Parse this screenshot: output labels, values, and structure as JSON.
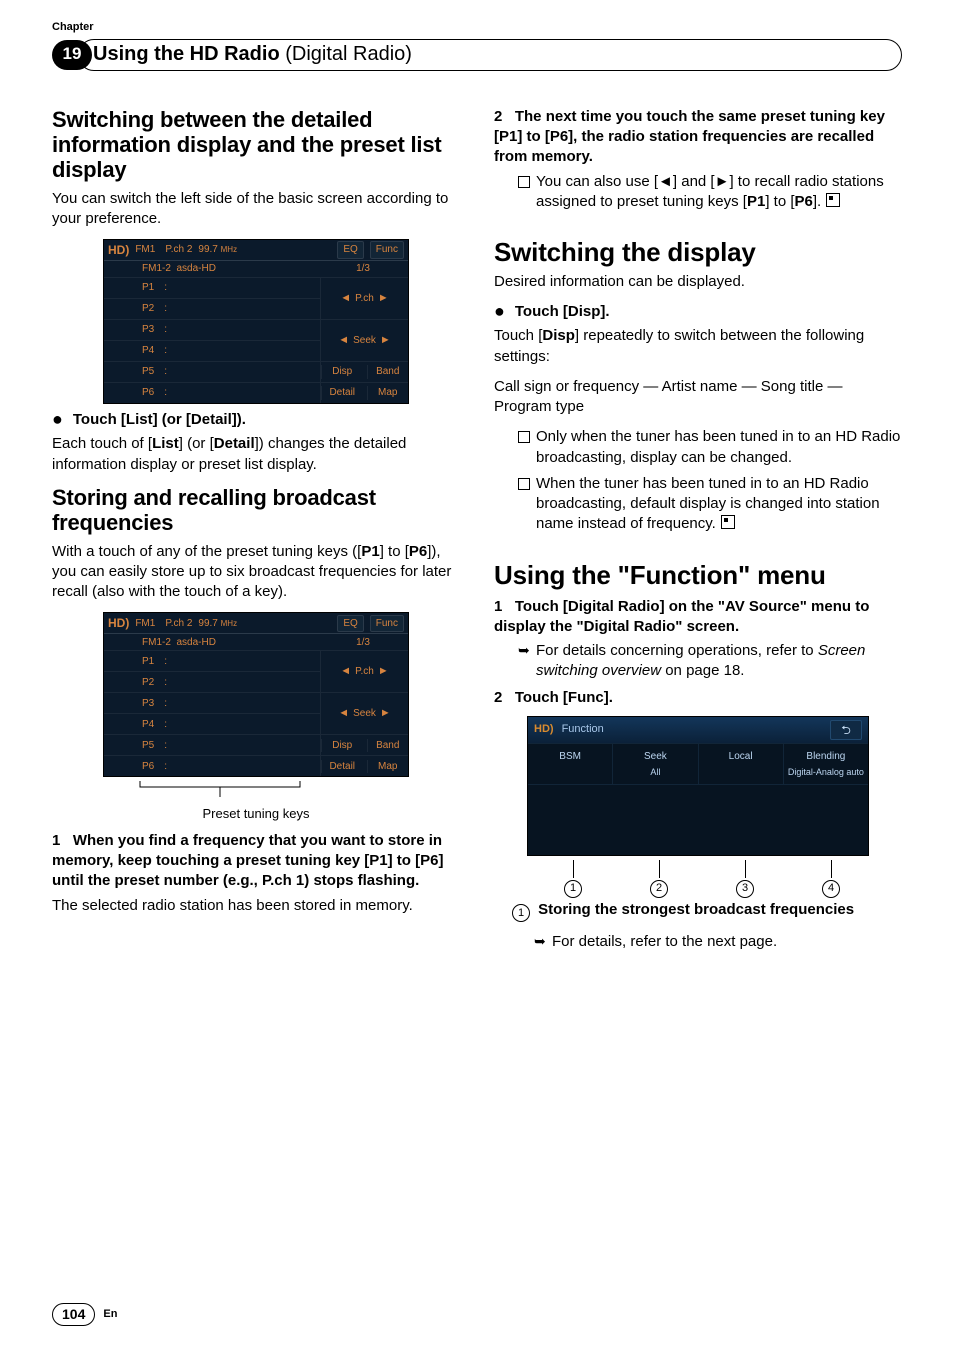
{
  "chapter": {
    "label": "Chapter",
    "number": "19",
    "title_strong": "Using the HD Radio",
    "title_paren": "(Digital Radio)"
  },
  "left": {
    "sec1_title": "Switching between the detailed information display and the preset list display",
    "sec1_body": "You can switch the left side of the basic screen according to your preference.",
    "bullet1": "Touch [List] (or [Detail]).",
    "bullet1_body_a": "Each touch of [",
    "bullet1_body_b": "List",
    "bullet1_body_c": "] (or [",
    "bullet1_body_d": "Detail",
    "bullet1_body_e": "]) changes the detailed information display or preset list display.",
    "sec2_title": "Storing and recalling broadcast frequencies",
    "sec2_body_a": "With a touch of any of the preset tuning keys ([",
    "sec2_body_b": "P1",
    "sec2_body_c": "] to [",
    "sec2_body_d": "P6",
    "sec2_body_e": "]), you can easily store up to six broadcast frequencies for later recall (also with the touch of a key).",
    "caption2": "Preset tuning keys",
    "step1_num": "1",
    "step1": "When you find a frequency that you want to store in memory, keep touching a preset tuning key [P1] to [P6] until the preset number (e.g., P.ch 1) stops flashing.",
    "step1_after": "The selected radio station has been stored in memory."
  },
  "right": {
    "step2_num": "2",
    "step2": "The next time you touch the same preset tuning key [P1] to [P6], the radio station frequencies are recalled from memory.",
    "note2_a": "You can also use [",
    "note2_b": "] and [",
    "note2_c": "] to recall radio stations assigned to preset tuning keys [",
    "note2_d": "P1",
    "note2_e": "] to [",
    "note2_f": "P6",
    "note2_g": "].",
    "secA_title": "Switching the display",
    "secA_body": "Desired information can be displayed.",
    "bulletA": "Touch [Disp].",
    "bulletA_body_a": "Touch [",
    "bulletA_body_b": "Disp",
    "bulletA_body_c": "] repeatedly to switch between the following settings:",
    "bulletA_body_d": "Call sign or frequency — Artist name — Song title — Program type",
    "noteA1": "Only when the tuner has been tuned in to an HD Radio broadcasting, display can be changed.",
    "noteA2": "When the tuner has been tuned in to an HD Radio broadcasting, default display is changed into station name instead of frequency.",
    "secB_title": "Using the \"Function\" menu",
    "secB_step1_num": "1",
    "secB_step1": "Touch [Digital Radio] on the \"AV Source\" menu to display the \"Digital Radio\" screen.",
    "secB_note1_a": "For details concerning operations, refer to ",
    "secB_note1_b": "Screen switching overview",
    "secB_note1_c": " on page 18.",
    "secB_step2_num": "2",
    "secB_step2": "Touch [Func].",
    "func": {
      "title": "Function",
      "c1": "BSM",
      "c2": "Seek",
      "c2s": "All",
      "c3": "Local",
      "c4": "Blending",
      "c4s": "Digital-Analog auto"
    },
    "callout_nums": [
      "1",
      "2",
      "3",
      "4"
    ],
    "item1_num": "1",
    "item1": "Storing the strongest broadcast frequencies",
    "item1_note": "For details, refer to the next page."
  },
  "radio": {
    "band": "FM1",
    "pch": "P.ch  2",
    "freq": "99.7",
    "unit": "MHz",
    "eq": "EQ",
    "func": "Func",
    "line2a": "FM1-2",
    "line2b": "asda-HD",
    "page": "1/3",
    "presets": [
      "P1",
      "P2",
      "P3",
      "P4",
      "P5",
      "P6"
    ],
    "side_pch": "P.ch",
    "side_seek": "Seek",
    "disp": "Disp",
    "bandbtn": "Band",
    "detail": "Detail",
    "map": "Map"
  },
  "footer": {
    "page": "104",
    "lang": "En"
  }
}
